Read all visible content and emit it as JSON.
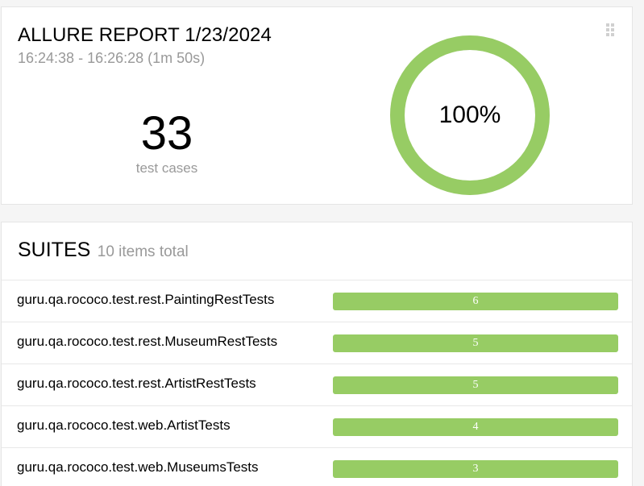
{
  "colors": {
    "passed": "#97cc64",
    "muted_text": "#999999"
  },
  "summary": {
    "title": "ALLURE REPORT 1/23/2024",
    "time_range": "16:24:38 - 16:26:28 (1m 50s)",
    "test_count": "33",
    "test_count_label": "test cases",
    "success_rate_text": "100%",
    "success_fraction": 1.0,
    "drag_handle_icon": "grip-dots-icon"
  },
  "suites": {
    "title": "SUITES",
    "total_label": "10 items total",
    "items": [
      {
        "name": "guru.qa.rococo.test.rest.PaintingRestTests",
        "count": "6"
      },
      {
        "name": "guru.qa.rococo.test.rest.MuseumRestTests",
        "count": "5"
      },
      {
        "name": "guru.qa.rococo.test.rest.ArtistRestTests",
        "count": "5"
      },
      {
        "name": "guru.qa.rococo.test.web.ArtistTests",
        "count": "4"
      },
      {
        "name": "guru.qa.rococo.test.web.MuseumsTests",
        "count": "3"
      }
    ]
  }
}
